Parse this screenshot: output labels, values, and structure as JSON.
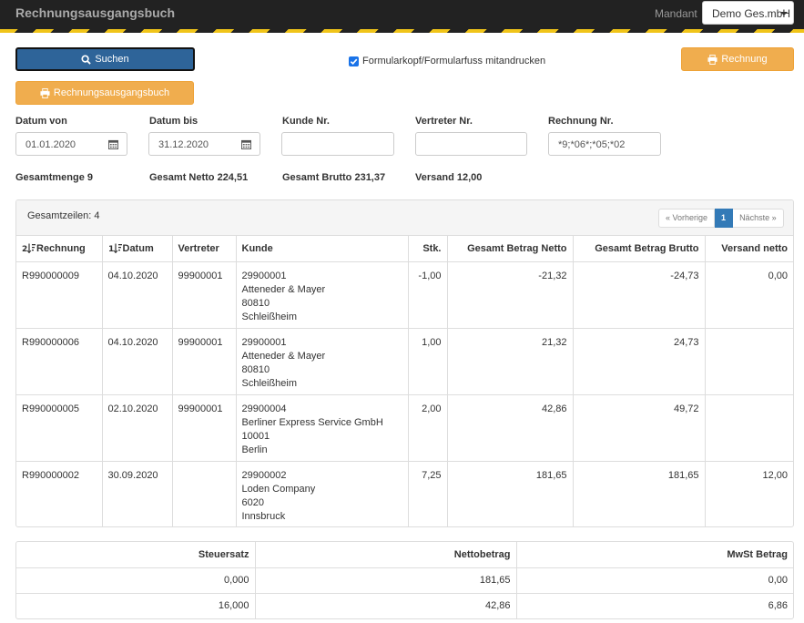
{
  "header": {
    "title": "Rechnungsausgangsbuch",
    "mandant_label": "Mandant",
    "mandant_value": "Demo Ges.mbH"
  },
  "toolbar": {
    "search_label": "Suchen",
    "print_header_label": "Formularkopf/Formularfuss mitandrucken",
    "print_header_checked": true,
    "invoice_label": "Rechnung",
    "book_label": "Rechnungsausgangsbuch"
  },
  "filters": {
    "date_from": {
      "label": "Datum von",
      "value": "01.01.2020"
    },
    "date_to": {
      "label": "Datum bis",
      "value": "31.12.2020"
    },
    "customer_no": {
      "label": "Kunde Nr.",
      "value": ""
    },
    "agent_no": {
      "label": "Vertreter Nr.",
      "value": ""
    },
    "invoice_no": {
      "label": "Rechnung Nr.",
      "value": "*9;*06*;*05;*02"
    }
  },
  "totals": {
    "quantity": "Gesamtmenge 9",
    "net": "Gesamt Netto 224,51",
    "gross": "Gesamt Brutto 231,37",
    "shipping": "Versand 12,00"
  },
  "results": {
    "row_count": "Gesamtzeilen: 4",
    "pager": {
      "prev": "« Vorherige",
      "current": "1",
      "next": "Nächste »"
    },
    "columns": {
      "invoice": "Rechnung",
      "date": "Datum",
      "agent": "Vertreter",
      "customer": "Kunde",
      "qty": "Stk.",
      "net": "Gesamt Betrag Netto",
      "gross": "Gesamt Betrag Brutto",
      "shipping": "Versand netto"
    },
    "rows": [
      {
        "invoice": "R990000009",
        "date": "04.10.2020",
        "agent": "99900001",
        "customer": [
          "29900001",
          "Atteneder & Mayer",
          "80810",
          "Schleißheim"
        ],
        "qty": "-1,00",
        "net": "-21,32",
        "gross": "-24,73",
        "shipping": "0,00"
      },
      {
        "invoice": "R990000006",
        "date": "04.10.2020",
        "agent": "99900001",
        "customer": [
          "29900001",
          "Atteneder & Mayer",
          "80810",
          "Schleißheim"
        ],
        "qty": "1,00",
        "net": "21,32",
        "gross": "24,73",
        "shipping": ""
      },
      {
        "invoice": "R990000005",
        "date": "02.10.2020",
        "agent": "99900001",
        "customer": [
          "29900004",
          "Berliner Express Service GmbH",
          "10001",
          "Berlin"
        ],
        "qty": "2,00",
        "net": "42,86",
        "gross": "49,72",
        "shipping": ""
      },
      {
        "invoice": "R990000002",
        "date": "30.09.2020",
        "agent": "",
        "customer": [
          "29900002",
          "Loden Company",
          "6020",
          "Innsbruck"
        ],
        "qty": "7,25",
        "net": "181,65",
        "gross": "181,65",
        "shipping": "12,00"
      }
    ]
  },
  "tax": {
    "columns": {
      "rate": "Steuersatz",
      "net": "Nettobetrag",
      "vat": "MwSt Betrag"
    },
    "rows": [
      {
        "rate": "0,000",
        "net": "181,65",
        "vat": "0,00"
      },
      {
        "rate": "16,000",
        "net": "42,86",
        "vat": "6,86"
      }
    ]
  }
}
